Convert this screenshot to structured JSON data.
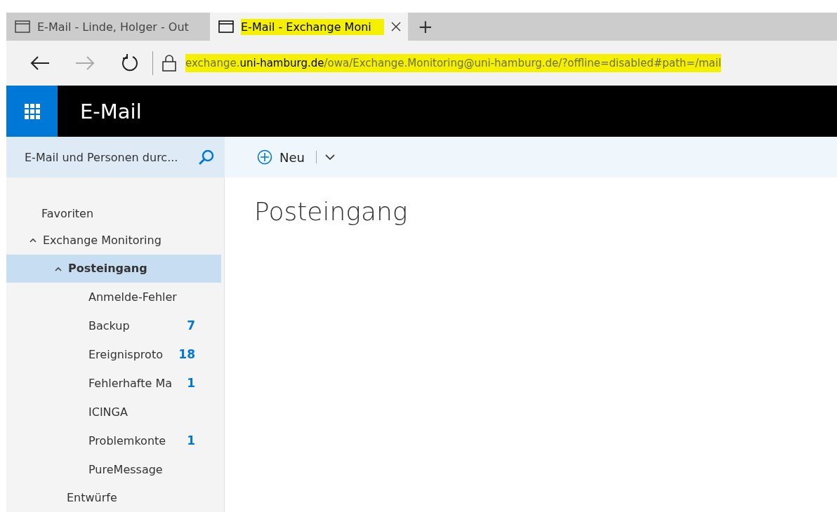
{
  "browser": {
    "tabs": [
      {
        "title": "E-Mail - Linde, Holger - Out",
        "selected": false,
        "highlighted": false
      },
      {
        "title": "E-Mail - Exchange Moni",
        "selected": true,
        "highlighted": true
      }
    ],
    "new_tab": "+",
    "address": {
      "highlighted": true,
      "parts": [
        {
          "text": "exchange.",
          "kind": "plain"
        },
        {
          "text": "uni-hamburg.de",
          "kind": "domain"
        },
        {
          "text": "/owa/Exchange.Monitoring@uni-hamburg.de/?offline=disabled#path=/mail",
          "kind": "plain"
        }
      ]
    }
  },
  "app": {
    "title": "E-Mail"
  },
  "search": {
    "placeholder": "E-Mail und Personen durc..."
  },
  "toolbar": {
    "new_button": "Neu"
  },
  "folders": [
    {
      "label": "Favoriten",
      "kind": "header"
    },
    {
      "label": "Exchange Monitoring",
      "kind": "account",
      "expanded": true,
      "children": [
        {
          "label": "Posteingang",
          "kind": "folder",
          "expanded": true,
          "selected": true,
          "children": [
            {
              "label": "Anmelde-Fehler",
              "kind": "folder",
              "selected": false
            },
            {
              "label": "Backup",
              "kind": "folder",
              "count": "7",
              "selected": false
            },
            {
              "label": "Ereignisproto",
              "kind": "folder",
              "count": "18",
              "selected": false
            },
            {
              "label": "Fehlerhafte Ma",
              "kind": "folder",
              "count": "1",
              "selected": false
            },
            {
              "label": "ICINGA",
              "kind": "folder",
              "selected": false
            },
            {
              "label": "Problemkonte",
              "kind": "folder",
              "count": "1",
              "selected": false
            },
            {
              "label": "PureMessage",
              "kind": "folder",
              "selected": false
            }
          ]
        },
        {
          "label": "Entwürfe",
          "kind": "folder",
          "selected": false
        }
      ]
    }
  ],
  "main": {
    "heading": "Posteingang"
  }
}
